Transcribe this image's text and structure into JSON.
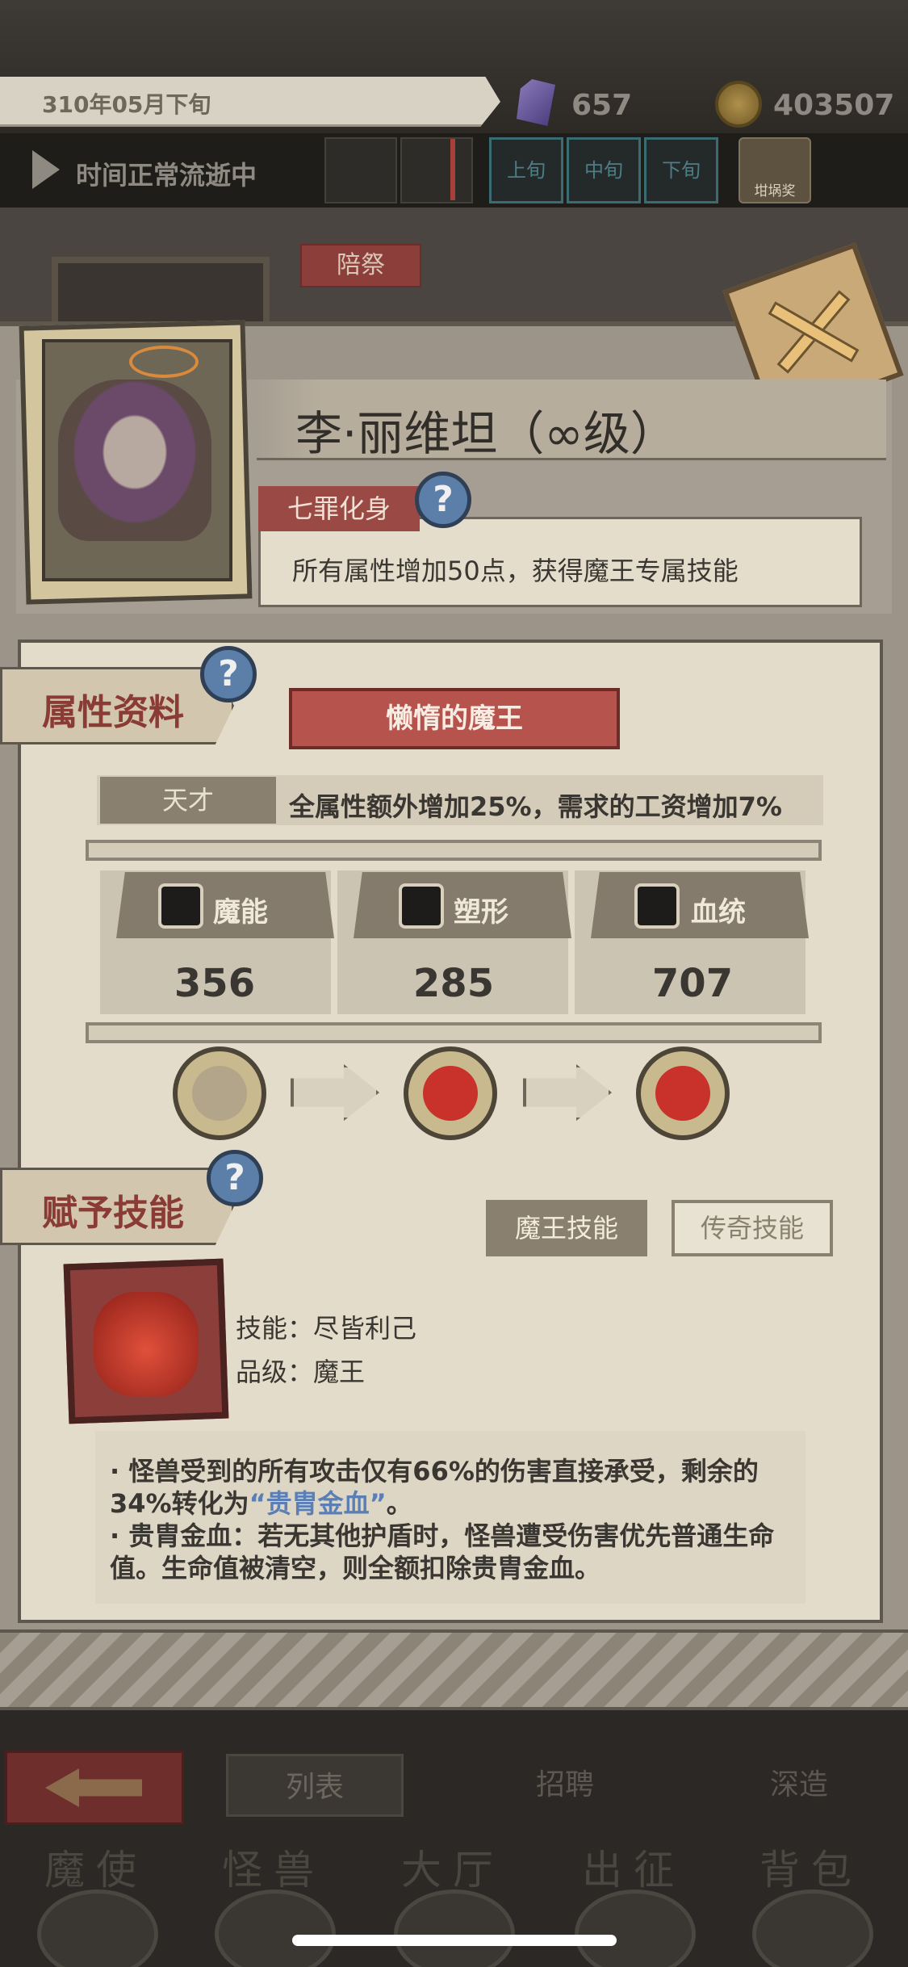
{
  "top": {
    "date": "310年05月下旬",
    "gems": "657",
    "coins": "403507",
    "time_status": "时间正常流逝中",
    "periods": [
      "上旬",
      "中旬",
      "下旬"
    ],
    "tomb_label": "坩埚奖"
  },
  "background": {
    "sacrifice_label": "陪祭"
  },
  "monster": {
    "name": "李·丽维坦（∞级）",
    "trait_tag": "七罪化身",
    "trait_desc": "所有属性增加50点，获得魔王专属技能"
  },
  "attributes": {
    "section_title": "属性资料",
    "form_name": "懒惰的魔王",
    "talent_tag": "天才",
    "talent_desc": "全属性额外增加25%，需求的工资增加7%",
    "stats": [
      {
        "label": "魔能",
        "value": "356"
      },
      {
        "label": "塑形",
        "value": "285"
      },
      {
        "label": "血统",
        "value": "707"
      }
    ]
  },
  "skills": {
    "section_title": "赋予技能",
    "tab_demon": "魔王技能",
    "tab_legend": "传奇技能",
    "skill_line": "技能：尽皆利己",
    "grade_line": "品级：魔王",
    "desc_1a": "·    怪兽受到的所有攻击仅有66%的伤害直接承受，剩余的34%转化为",
    "desc_1b": "“贵胄金血”",
    "desc_1c": "。",
    "desc_2": "·    贵胄金血：若无其他护盾时，怪兽遭受伤害优先普通生命值。生命值被清空，则全额扣除贵胄金血。"
  },
  "nav": {
    "sub_tabs": [
      "列表",
      "招聘",
      "深造"
    ],
    "main_tabs": [
      "魔使",
      "怪兽",
      "大厅",
      "出征",
      "背包"
    ]
  },
  "colors": {
    "accent_red": "#9b4944",
    "highlight_blue": "#5b7fb5",
    "parchment": "#e3dccb"
  }
}
